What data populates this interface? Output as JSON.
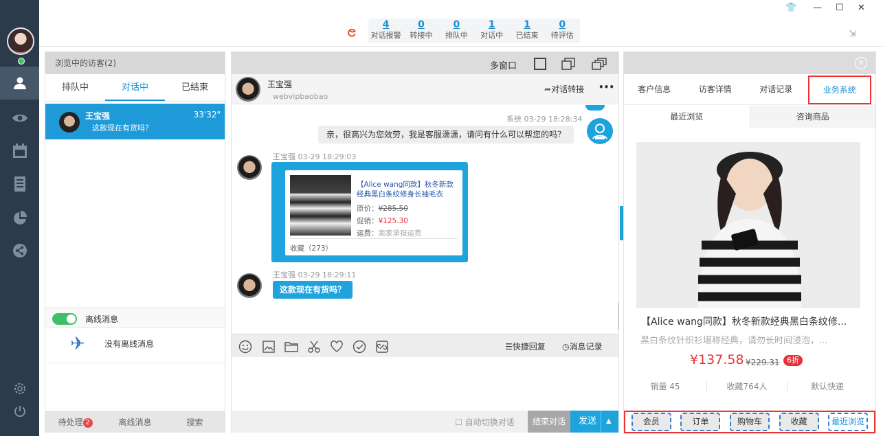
{
  "stats": [
    {
      "value": "4",
      "label": "对话报警"
    },
    {
      "value": "0",
      "label": "转接中"
    },
    {
      "value": "0",
      "label": "排队中"
    },
    {
      "value": "1",
      "label": "对话中"
    },
    {
      "value": "1",
      "label": "已结束"
    },
    {
      "value": "0",
      "label": "待评估"
    }
  ],
  "window": {
    "skin": "👕",
    "minimize": "—",
    "maximize": "☐",
    "close": "✕"
  },
  "visitors": {
    "header": "浏览中的访客(2)",
    "tabs": [
      "排队中",
      "对话中",
      "已结束"
    ],
    "active_tab": 1,
    "item": {
      "name": "王宝强",
      "time": "33'32\"",
      "message": "这款现在有货吗？"
    },
    "offline_toggle_label": "离线消息",
    "no_offline": "没有离线消息",
    "bottom_tabs": {
      "pending": "待处理",
      "pending_count": "2",
      "offline": "离线消息",
      "search": "搜索"
    }
  },
  "chat": {
    "multi_window": "多窗口",
    "contact_name": "王宝强",
    "contact_sub": "webvipbaobao",
    "transfer": "对话转接",
    "more": "•••",
    "sys_meta": "系统  03-29 18:28:34",
    "sys_message": "亲，很高兴为您效劳，我是客服潇潇，请问有什么可以帮您的吗？",
    "msg1_meta": "王宝强  03-29 18:29:03",
    "product": {
      "title": "【Alice wang同款】秋冬新款经典黑白条纹修身长袖毛衣",
      "orig_label": "原价：",
      "orig_price": "¥285.50",
      "promo_label": "促销：",
      "promo_price": "¥125.30",
      "ship_label": "运费：",
      "ship_value": "卖家承担运费",
      "fav": "收藏（273）"
    },
    "msg2_meta": "王宝强  03-29 18:29:11",
    "msg2_text": "这款现在有货吗？",
    "quick_reply": "快捷回复",
    "history": "消息记录",
    "auto_switch": "自动切换对话",
    "end": "结束对话",
    "send": "发送"
  },
  "right": {
    "tabs": [
      "客户信息",
      "访客详情",
      "对话记录",
      "业务系统"
    ],
    "subtabs": [
      "最近浏览",
      "咨询商品"
    ],
    "product_title": "【Alice wang同款】秋冬新款经典黑白条纹修...",
    "product_desc": "黑白条纹针织衫堪称经典，请勿长时间浸泡，...",
    "price": "¥137.58",
    "orig_price": "¥229.31",
    "discount": "6折",
    "sales": "销量 45",
    "favorites": "收藏764人",
    "shipping": "默认快递",
    "bottom_buttons": [
      "会员",
      "订单",
      "购物车",
      "收藏",
      "最近浏览"
    ]
  },
  "colors": {
    "accent": "#1ea3dd",
    "sidebar": "#2c3b4a",
    "price": "#e5333a",
    "highlight": "#e33333"
  }
}
